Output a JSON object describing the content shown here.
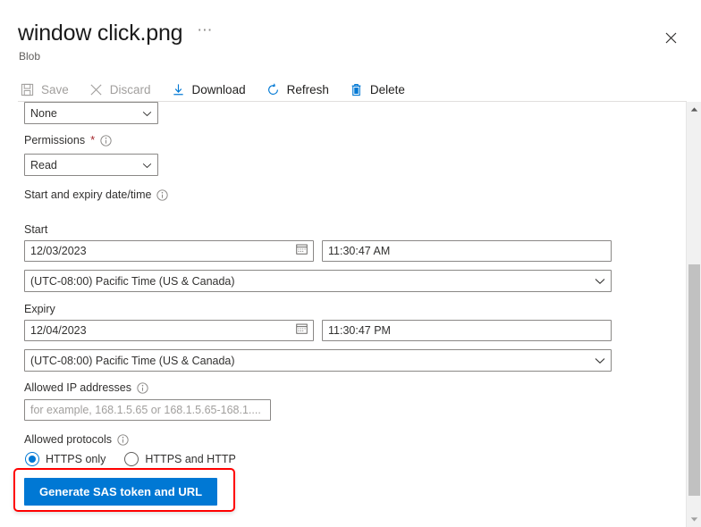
{
  "header": {
    "title": "window click.png",
    "subtitle": "Blob",
    "ellipsis_label": "⋯",
    "close_icon": "close-icon"
  },
  "toolbar": {
    "items": [
      {
        "label": "Save",
        "icon": "save-icon",
        "enabled": false
      },
      {
        "label": "Discard",
        "icon": "discard-icon",
        "enabled": false
      },
      {
        "label": "Download",
        "icon": "download-icon",
        "enabled": true
      },
      {
        "label": "Refresh",
        "icon": "refresh-icon",
        "enabled": true
      },
      {
        "label": "Delete",
        "icon": "delete-icon",
        "enabled": true
      }
    ]
  },
  "form": {
    "clipped_select": {
      "value": "None"
    },
    "permissions": {
      "label": "Permissions",
      "required_marker": "*",
      "value": "Read"
    },
    "date_section": {
      "label": "Start and expiry date/time"
    },
    "start": {
      "label": "Start",
      "date": "12/03/2023",
      "time": "11:30:47 AM",
      "timezone": "(UTC-08:00) Pacific Time (US & Canada)"
    },
    "expiry": {
      "label": "Expiry",
      "date": "12/04/2023",
      "time": "11:30:47 PM",
      "timezone": "(UTC-08:00) Pacific Time (US & Canada)"
    },
    "allowed_ip": {
      "label": "Allowed IP addresses",
      "value": "",
      "placeholder": "for example, 168.1.5.65 or 168.1.5.65-168.1...."
    },
    "allowed_protocols": {
      "label": "Allowed protocols",
      "options": [
        {
          "label": "HTTPS only",
          "selected": true
        },
        {
          "label": "HTTPS and HTTP",
          "selected": false
        }
      ]
    },
    "generate_button": {
      "label": "Generate SAS token and URL"
    }
  },
  "scrollbar": {
    "up_icon": "scroll-up-arrow-icon",
    "down_icon": "scroll-down-arrow-icon"
  },
  "colors": {
    "accent": "#0078D4",
    "annotation": "#FF0000",
    "required": "#A4262C",
    "disabled_text": "#A19F9D",
    "text": "#323130"
  }
}
